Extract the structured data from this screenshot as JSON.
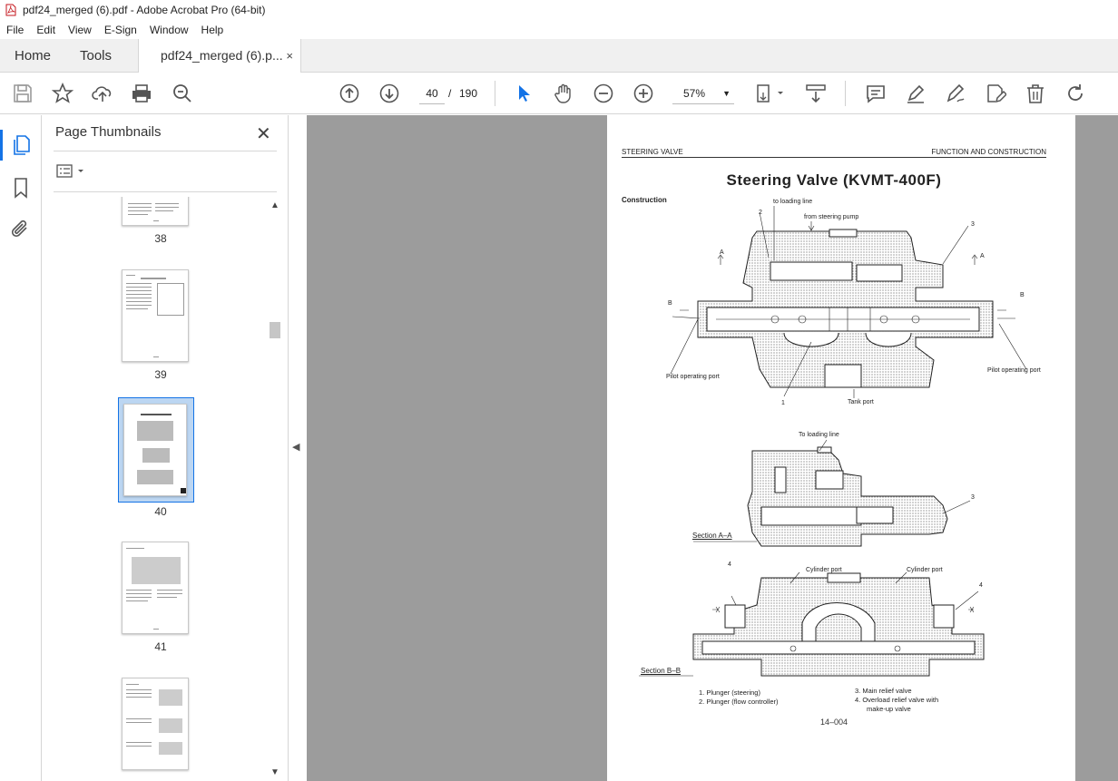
{
  "window": {
    "title": "pdf24_merged (6).pdf - Adobe Acrobat Pro (64-bit)"
  },
  "menu": [
    "File",
    "Edit",
    "View",
    "E-Sign",
    "Window",
    "Help"
  ],
  "tabs": {
    "home": "Home",
    "tools": "Tools",
    "document": "pdf24_merged (6).p...",
    "close": "×"
  },
  "toolbar": {
    "current_page": "40",
    "page_separator": "/",
    "total_pages": "190",
    "zoom": "57%"
  },
  "panel": {
    "title": "Page Thumbnails",
    "close": "✕",
    "thumbnails": [
      {
        "label": "38"
      },
      {
        "label": "39"
      },
      {
        "label": "40",
        "selected": true
      },
      {
        "label": "41"
      },
      {
        "label": ""
      }
    ]
  },
  "document_page": {
    "header_left": "STEERING VALVE",
    "header_right": "FUNCTION AND CONSTRUCTION",
    "title": "Steering  Valve  (KVMT-400F)",
    "subtitle": "Construction",
    "labels": {
      "to_loading_line_top": "to loading line",
      "from_steering_pump": "from steering pump",
      "pilot_port_left": "Pilot operating port",
      "pilot_port_right": "Pilot operating port",
      "tank_port": "Tank port",
      "to_loading_line_mid": "To loading line",
      "cyl_port_left": "Cylinder port",
      "cyl_port_right": "Cylinder port",
      "n2": "2",
      "n3_top": "3",
      "n3_mid": "3",
      "n4_left": "4",
      "n4_right": "4",
      "n1": "1",
      "a_left": "A",
      "a_right": "A",
      "b_left": "B",
      "b_right": "B"
    },
    "section_aa": "Section A–A",
    "section_bb": "Section B–B",
    "legend": {
      "item1": "1.   Plunger (steering)",
      "item2": "2.   Plunger (flow controller)",
      "item3": "3.   Main relief valve",
      "item4a": "4.   Overload relief valve with",
      "item4b": "make-up valve"
    },
    "page_number": "14–004"
  }
}
